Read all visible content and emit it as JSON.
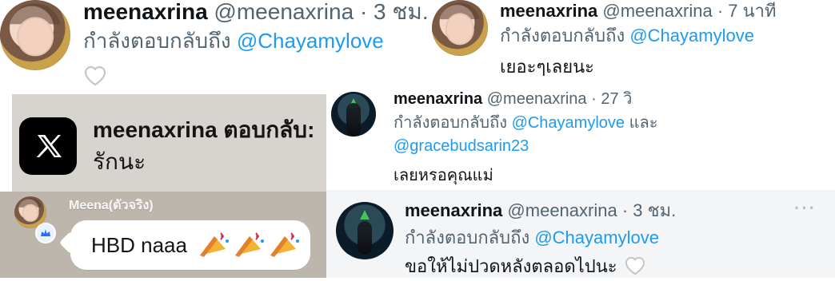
{
  "colors": {
    "accent": "#1d9bf0",
    "text": "#0f1419",
    "muted": "#536471",
    "panel": "#d7d4d0",
    "panel_dark": "#bdb6ad"
  },
  "tweets": {
    "top_left": {
      "name": "meenaxrina",
      "handle": "@meenaxrina",
      "sep": "·",
      "time": "3 ชม.",
      "reply_prefix": "กำลังตอบกลับถึง",
      "mention": "@Chayamylove",
      "icon_heart": "heart-outline-icon"
    },
    "top_right": {
      "name": "meenaxrina",
      "handle": "@meenaxrina",
      "sep": "·",
      "time": "7 นาที",
      "reply_prefix": "กำลังตอบกลับถึง",
      "mention": "@Chayamylove",
      "text": "เยอะๆเลยนะ"
    },
    "middle_right": {
      "name": "meenaxrina",
      "handle": "@meenaxrina",
      "sep": "·",
      "time": "27 วิ",
      "reply_prefix": "กำลังตอบกลับถึง",
      "mention1": "@Chayamylove",
      "and": "และ",
      "mention2": "@gracebudsarin23",
      "text": "เลยหรอคุณแม่"
    },
    "bottom_right": {
      "name": "meenaxrina",
      "handle": "@meenaxrina",
      "sep": "·",
      "time": "3 ชม.",
      "reply_prefix": "กำลังตอบกลับถึง",
      "mention": "@Chayamylove",
      "text": "ขอให้ไม่ปวดหลังตลอดไปนะ",
      "icon_heart": "heart-outline-icon",
      "more": "···"
    }
  },
  "notification": {
    "logo": "x-logo-icon",
    "title": "meenaxrina ตอบกลับ:",
    "body": "รักนะ"
  },
  "chat": {
    "sender": "Meena(ตัวจริง)",
    "message": "HBD naaa",
    "badge_icon": "crown-badge-icon",
    "emoji_icon": "party-popper-icon"
  }
}
